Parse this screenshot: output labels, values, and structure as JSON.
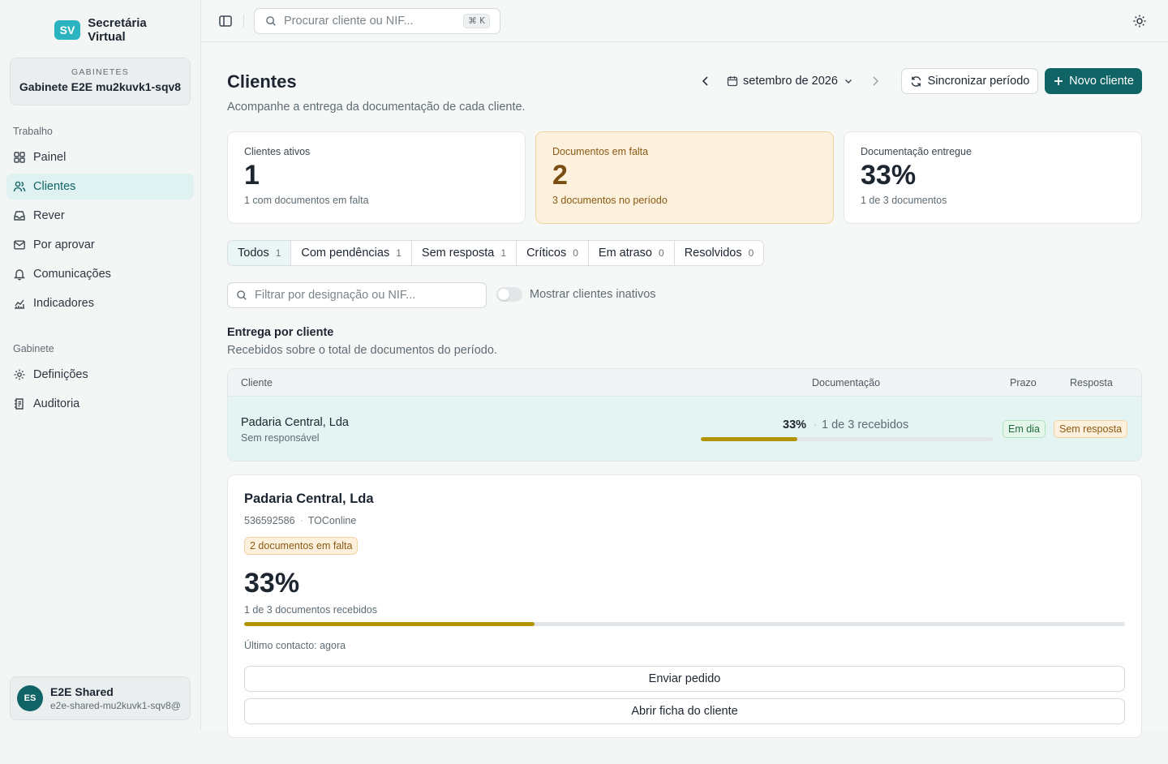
{
  "brand": {
    "line1": "Secretária",
    "line2": "Virtual"
  },
  "workspace": {
    "label": "GABINETES",
    "name": "Gabinete E2E mu2kuvk1-sqv8"
  },
  "sidebar": {
    "section_work": "Trabalho",
    "section_office": "Gabinete",
    "items": [
      {
        "label": "Painel",
        "icon": "grid-icon"
      },
      {
        "label": "Clientes",
        "icon": "users-icon",
        "active": true
      },
      {
        "label": "Rever",
        "icon": "inbox-icon"
      },
      {
        "label": "Por aprovar",
        "icon": "mail-icon"
      },
      {
        "label": "Comunicações",
        "icon": "bell-icon"
      },
      {
        "label": "Indicadores",
        "icon": "chart-icon"
      },
      {
        "label": "Definições",
        "icon": "gear-icon"
      },
      {
        "label": "Auditoria",
        "icon": "audit-icon"
      }
    ]
  },
  "user": {
    "initials": "ES",
    "name": "E2E Shared",
    "email": "e2e-shared-mu2kuvk1-sqv8@"
  },
  "topbar": {
    "search_placeholder": "Procurar cliente ou NIF...",
    "shortcut": "⌘ K"
  },
  "page": {
    "title": "Clientes",
    "subtitle": "Acompanhe a entrega da documentação de cada cliente.",
    "period": "setembro de 2026",
    "sync_label": "Sincronizar período",
    "new_label": "Novo cliente"
  },
  "stats": [
    {
      "label": "Clientes ativos",
      "value": "1",
      "hint": "1 com documentos em falta"
    },
    {
      "label": "Documentos em falta",
      "value": "2",
      "hint": "3 documentos no período"
    },
    {
      "label": "Documentação entregue",
      "value": "33%",
      "hint": "1 de 3 documentos"
    }
  ],
  "filters": [
    {
      "label": "Todos",
      "count": "1",
      "active": true
    },
    {
      "label": "Com pendências",
      "count": "1"
    },
    {
      "label": "Sem resposta",
      "count": "1"
    },
    {
      "label": "Críticos",
      "count": "0"
    },
    {
      "label": "Em atraso",
      "count": "0"
    },
    {
      "label": "Resolvidos",
      "count": "0"
    }
  ],
  "client_filter": {
    "placeholder": "Filtrar por designação ou NIF...",
    "inactive_toggle": "Mostrar clientes inativos",
    "inactive_on": false
  },
  "delivery": {
    "title": "Entrega por cliente",
    "subtitle": "Recebidos sobre o total de documentos do período.",
    "columns": [
      "Cliente",
      "Documentação",
      "Prazo",
      "Resposta"
    ],
    "rows": [
      {
        "name": "Padaria Central, Lda",
        "owner": "Sem responsável",
        "pct": "33%",
        "received": "1 de 3 recebidos",
        "progress": 0.33,
        "deadline": "Em dia",
        "response": "Sem resposta"
      }
    ]
  },
  "detail": {
    "name": "Padaria Central, Lda",
    "nif": "536592586",
    "source": "TOConline",
    "badge": "2 documentos em falta",
    "pct": "33%",
    "received": "1 de 3 documentos recebidos",
    "progress": 0.33,
    "last_contact": "Último contacto: agora",
    "send_label": "Enviar pedido",
    "open_label": "Abrir ficha do cliente"
  }
}
